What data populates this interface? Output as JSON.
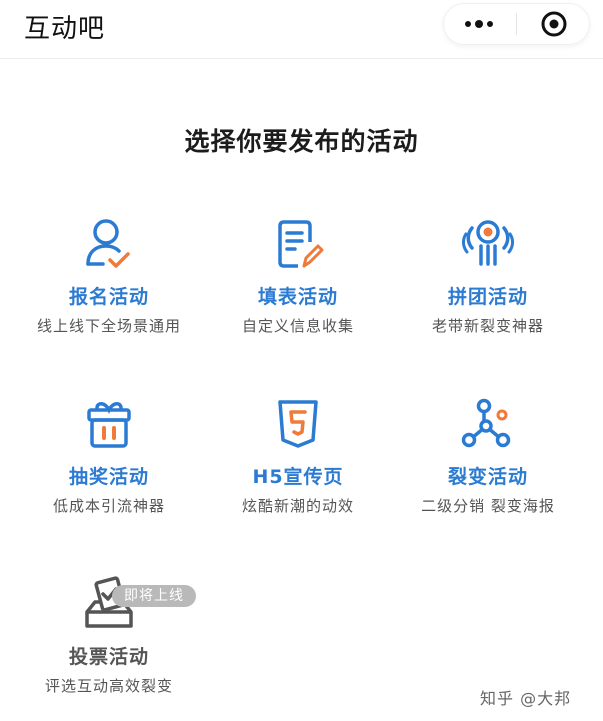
{
  "header": {
    "title": "互动吧",
    "more_icon": "more-dots-icon",
    "close_icon": "target-circle-icon"
  },
  "main": {
    "heading": "选择你要发布的活动",
    "activities": [
      {
        "title": "报名活动",
        "subtitle": "线上线下全场景通用",
        "icon": "user-check-icon"
      },
      {
        "title": "填表活动",
        "subtitle": "自定义信息收集",
        "icon": "form-pen-icon"
      },
      {
        "title": "拼团活动",
        "subtitle": "老带新裂变神器",
        "icon": "group-hands-icon"
      },
      {
        "title": "抽奖活动",
        "subtitle": "低成本引流神器",
        "icon": "gift-box-icon"
      },
      {
        "title": "H5宣传页",
        "subtitle": "炫酷新潮的动效",
        "icon": "html5-icon"
      },
      {
        "title": "裂变活动",
        "subtitle": "二级分销 裂变海报",
        "icon": "network-nodes-icon"
      },
      {
        "title": "投票活动",
        "subtitle": "评选互动高效裂变",
        "icon": "vote-box-icon",
        "badge": "即将上线"
      }
    ]
  },
  "watermark": "知乎 @大邦",
  "colors": {
    "accent_blue": "#2b7bd3",
    "accent_orange": "#f07a3a",
    "disabled_gray": "#555555",
    "badge_gray": "#b9b9b9"
  }
}
